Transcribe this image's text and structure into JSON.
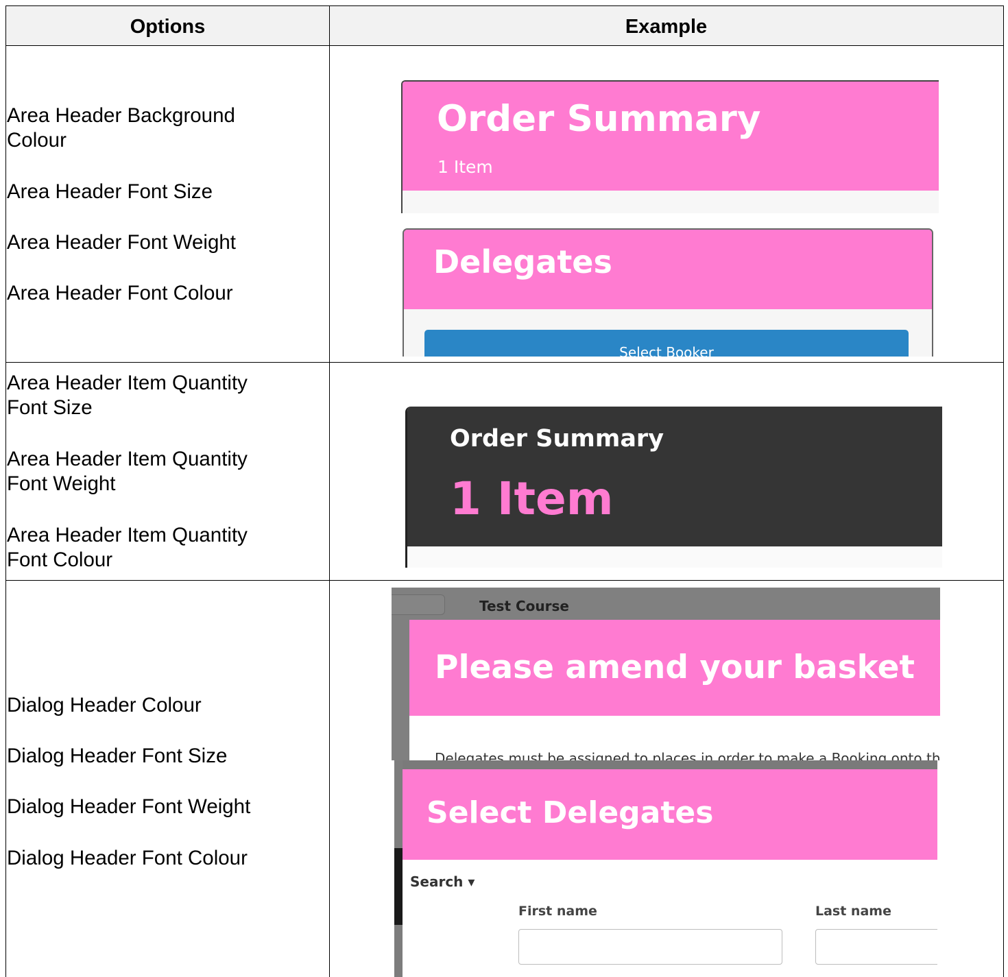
{
  "table": {
    "headers": {
      "options": "Options",
      "example": "Example"
    },
    "rows": [
      {
        "options": [
          "Area Header Background\nColour",
          "Area Header Font Size",
          "Area Header Font Weight",
          "Area Header Font Colour"
        ]
      },
      {
        "options": [
          "Area Header Item Quantity\nFont Size",
          "Area Header Item Quantity\nFont Weight",
          "Area Header Item Quantity\nFont Colour"
        ]
      },
      {
        "options": [
          "Dialog Header Colour",
          "Dialog Header Font Size",
          "Dialog Header Font Weight",
          "Dialog Header Font Colour"
        ]
      }
    ]
  },
  "examples": {
    "order_summary_pink": {
      "title": "Order Summary",
      "subtitle": "1 Item"
    },
    "delegates_pink": {
      "title": "Delegates",
      "button_label": "Select Booker"
    },
    "order_summary_dark": {
      "title": "Order Summary",
      "subtitle": "1 Item"
    },
    "dialog_amend": {
      "course": "Test Course",
      "title": "Please amend your basket",
      "body": "Delegates must be assigned to places in order to make a Booking onto the W"
    },
    "dialog_select": {
      "title": "Select Delegates",
      "search_label": "Search ▾",
      "first_name_label": "First name",
      "last_name_label": "Last name"
    }
  },
  "colors": {
    "header_pink": "#ff7bd1",
    "header_dark": "#353535",
    "button_blue": "#2a86c6",
    "quantity_pink": "#ff7bd1"
  }
}
